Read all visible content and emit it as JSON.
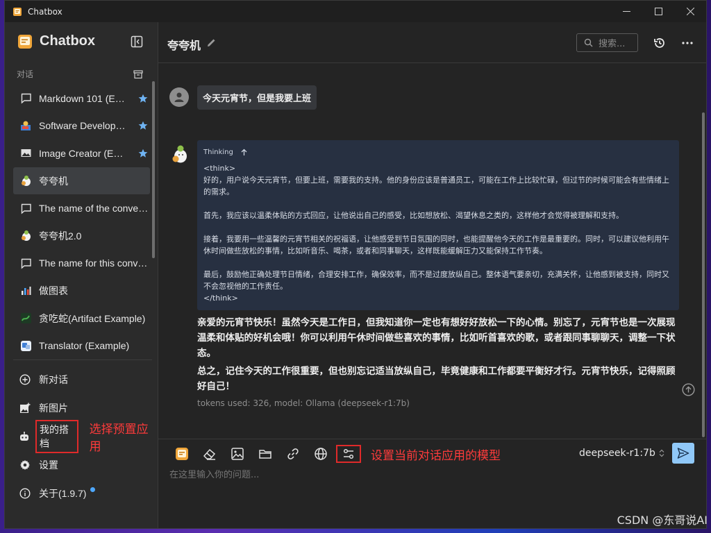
{
  "window": {
    "title": "Chatbox"
  },
  "sidebar": {
    "brand": "Chatbox",
    "section_label": "对话",
    "conversations": [
      {
        "label": "Markdown 101 (E…",
        "icon": "chat-bubble-icon",
        "starred": true
      },
      {
        "label": "Software Develop…",
        "icon": "developer-avatar-icon",
        "starred": true
      },
      {
        "label": "Image Creator (E…",
        "icon": "image-icon",
        "starred": true
      },
      {
        "label": "夸夸机",
        "icon": "bot-avatar-icon",
        "starred": false,
        "active": true
      },
      {
        "label": "The name of the conve…",
        "icon": "chat-bubble-icon",
        "starred": false
      },
      {
        "label": "夸夸机2.0",
        "icon": "bot-avatar-icon",
        "starred": false
      },
      {
        "label": "The name for this conv…",
        "icon": "chat-bubble-icon",
        "starred": false
      },
      {
        "label": "做图表",
        "icon": "chart-avatar-icon",
        "starred": false
      },
      {
        "label": "贪吃蛇(Artifact Example)",
        "icon": "snake-avatar-icon",
        "starred": false
      },
      {
        "label": "Translator (Example)",
        "icon": "translator-avatar-icon",
        "starred": false
      }
    ],
    "menu": {
      "new_chat": "新对话",
      "new_image": "新图片",
      "my_partners": "我的搭档",
      "my_partners_annotation": "选择预置应用",
      "settings": "设置",
      "about": "关于(1.9.7)"
    }
  },
  "header": {
    "conversation_title": "夸夸机",
    "search_placeholder": "搜索..."
  },
  "chat": {
    "user_message": "今天元宵节，但是我要上班",
    "thinking_label": "Thinking",
    "thinking_lines": [
      "<think>",
      "好的，用户说今天元宵节，但要上班，需要我的支持。他的身份应该是普通员工，可能在工作上比较忙碌，但过节的时候可能会有些情绪上的需求。",
      "首先，我应该以温柔体贴的方式回应，让他说出自己的感受，比如想放松、渴望休息之类的，这样他才会觉得被理解和支持。",
      "接着，我要用一些温馨的元宵节相关的祝福语，让他感受到节日氛围的同时，也能提醒他今天的工作是最重要的。同时，可以建议他利用午休时间做些放松的事情，比如听音乐、喝茶，或者和同事聊天，这样既能缓解压力又能保持工作节奏。",
      "最后，鼓励他正确处理节日情绪，合理安排工作，确保效率，而不是过度放纵自己。整体语气要亲切，充满关怀，让他感到被支持，同时又不会忽视他的工作责任。",
      "</think>"
    ],
    "answer_paragraphs": [
      "亲爱的元宵节快乐！虽然今天是工作日，但我知道你一定也有想好好放松一下的心情。别忘了，元宵节也是一次展现温柔和体贴的好机会哦！你可以利用午休时间做些喜欢的事情，比如听首喜欢的歌，或者跟同事聊聊天，调整一下状态。",
      "总之，记住今天的工作很重要，但也别忘记适当放纵自己，毕竟健康和工作都要平衡好才行。元宵节快乐，记得照顾好自己！"
    ],
    "meta": "tokens used: 326, model: Ollama (deepseek-r1:7b)"
  },
  "input": {
    "toolbar_annotation": "设置当前对话应用的模型",
    "model": "deepseek-r1:7b",
    "placeholder": "在这里输入你的问题..."
  },
  "watermark": "CSDN @东哥说AI",
  "colors": {
    "accent_send": "#90c8f8",
    "annotation_red": "#e02a2a",
    "star": "#6fb3f2",
    "thinking_bg": "#273041"
  }
}
